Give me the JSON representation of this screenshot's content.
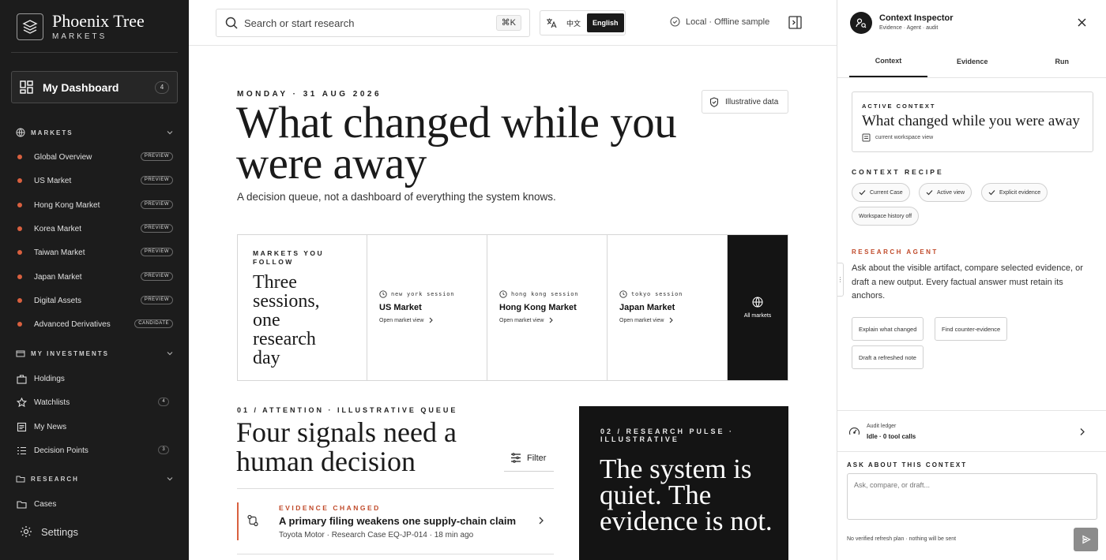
{
  "sidebar": {
    "brand_name": "Phoenix Tree",
    "brand_sub": "MARKETS",
    "dashboard": {
      "label": "My Dashboard",
      "count": "4"
    },
    "markets_section": "MARKETS",
    "markets": [
      {
        "label": "Global Overview",
        "tag": "PREVIEW",
        "dot": "#d9603f"
      },
      {
        "label": "US Market",
        "tag": "PREVIEW",
        "dot": "#d9603f"
      },
      {
        "label": "Hong Kong Market",
        "tag": "PREVIEW",
        "dot": "#d9603f"
      },
      {
        "label": "Korea Market",
        "tag": "PREVIEW",
        "dot": "#d9603f"
      },
      {
        "label": "Taiwan Market",
        "tag": "PREVIEW",
        "dot": "#d9603f"
      },
      {
        "label": "Japan Market",
        "tag": "PREVIEW",
        "dot": "#d9603f"
      },
      {
        "label": "Digital Assets",
        "tag": "PREVIEW",
        "dot": "#d9603f"
      },
      {
        "label": "Advanced Derivatives",
        "tag": "CANDIDATE",
        "dot": "#d9603f"
      }
    ],
    "investments_section": "MY INVESTMENTS",
    "investments": [
      {
        "label": "Holdings",
        "icon": "briefcase-icon",
        "count": ""
      },
      {
        "label": "Watchlists",
        "icon": "star-icon",
        "count": "4"
      },
      {
        "label": "My News",
        "icon": "news-icon",
        "count": ""
      },
      {
        "label": "Decision Points",
        "icon": "list-icon",
        "count": "3"
      }
    ],
    "research_section": "RESEARCH",
    "research": [
      {
        "label": "Cases",
        "icon": "folder-icon"
      }
    ],
    "settings_label": "Settings"
  },
  "topbar": {
    "search_placeholder": "Search or start research",
    "shortcut": "⌘K",
    "lang_zh": "中文",
    "lang_en": "English",
    "mode": "Local · Offline sample"
  },
  "main": {
    "dateline": "MONDAY · 31 AUG 2026",
    "illustrative_label": "Illustrative data",
    "hero_title": "What changed while you were away",
    "hero_sub": "A decision queue, not a dashboard of everything the system knows.",
    "markets_kicker": "MARKETS YOU FOLLOW",
    "markets_heading": "Three sessions, one research day",
    "sessions": [
      {
        "session": "NEW YORK SESSION",
        "market": "US Market",
        "link": "Open market view"
      },
      {
        "session": "HONG KONG SESSION",
        "market": "Hong Kong Market",
        "link": "Open market view"
      },
      {
        "session": "TOKYO SESSION",
        "market": "Japan Market",
        "link": "Open market view"
      }
    ],
    "all_markets": "All markets",
    "signals_kicker": "01 / ATTENTION · ILLUSTRATIVE QUEUE",
    "signals_heading": "Four signals need a human decision",
    "filter_label": "Filter",
    "signal": {
      "kicker": "EVIDENCE CHANGED",
      "title": "A primary filing weakens one supply-chain claim",
      "meta": "Toyota Motor · Research Case EQ-JP-014 · 18 min ago"
    },
    "pulse_kicker": "02 / RESEARCH PULSE · ILLUSTRATIVE",
    "pulse_heading": "The system is quiet. The evidence is not."
  },
  "panel": {
    "title": "Context Inspector",
    "subtitle": "Evidence · Agent · audit",
    "tabs": [
      "Context",
      "Evidence",
      "Run"
    ],
    "active_kicker": "ACTIVE CONTEXT",
    "active_title": "What changed while you were away",
    "active_scope": "current workspace view",
    "recipe_kicker": "CONTEXT RECIPE",
    "recipe_chips": [
      "Current Case",
      "Active view",
      "Explicit evidence"
    ],
    "recipe_off": "Workspace history off",
    "agent_kicker": "RESEARCH AGENT",
    "agent_text": "Ask about the visible artifact, compare selected evidence, or draft a new output. Every factual answer must retain its anchors.",
    "actions": [
      "Explain what changed",
      "Find counter-evidence",
      "Draft a refreshed note"
    ],
    "ledger_label": "Audit ledger",
    "ledger_status": "Idle · 0 tool calls",
    "ask_kicker": "ASK ABOUT THIS CONTEXT",
    "ask_placeholder": "Ask, compare, or draft...",
    "ask_footer": "No verified refresh plan · nothing will be sent"
  },
  "colors": {
    "accent": "#d9603f",
    "sidebar_bg": "#1c1c1c",
    "dark_card": "#141414"
  }
}
